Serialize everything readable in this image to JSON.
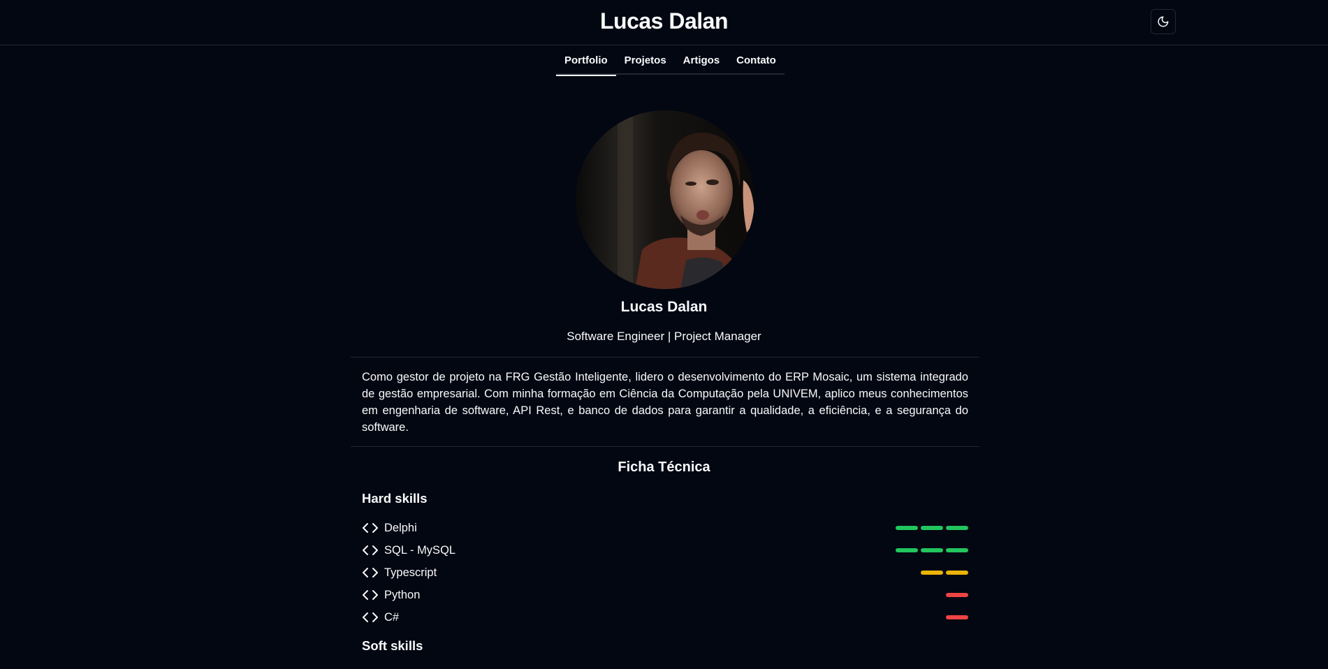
{
  "header": {
    "title": "Lucas Dalan",
    "theme_toggle_icon": "moon-icon"
  },
  "nav": {
    "tabs": [
      {
        "label": "Portfolio",
        "active": true
      },
      {
        "label": "Projetos",
        "active": false
      },
      {
        "label": "Artigos",
        "active": false
      },
      {
        "label": "Contato",
        "active": false
      }
    ]
  },
  "profile": {
    "name": "Lucas Dalan",
    "role": "Software Engineer | Project Manager",
    "bio": "Como gestor de projeto na FRG Gestão Inteligente, lidero o desenvolvimento do ERP Mosaic, um sistema integrado de gestão empresarial. Com minha formação em Ciência da Computação pela UNIVEM, aplico meus conhecimentos em engenharia de software, API Rest, e banco de dados para garantir a qualidade, a eficiência, e a segurança do software."
  },
  "ficha": {
    "title": "Ficha Técnica",
    "hard_skills_title": "Hard skills",
    "soft_skills_title": "Soft skills",
    "skill_icon": "code-icon",
    "level_colors": {
      "3": "#22c55e",
      "2": "#eab308",
      "1": "#ef4444"
    },
    "hard_skills": [
      {
        "name": "Delphi",
        "level": 3
      },
      {
        "name": "SQL - MySQL",
        "level": 3
      },
      {
        "name": "Typescript",
        "level": 2
      },
      {
        "name": "Python",
        "level": 1
      },
      {
        "name": "C#",
        "level": 1
      }
    ]
  },
  "colors": {
    "background": "#030712",
    "border": "#1f2937",
    "text": "#f9fafb"
  }
}
